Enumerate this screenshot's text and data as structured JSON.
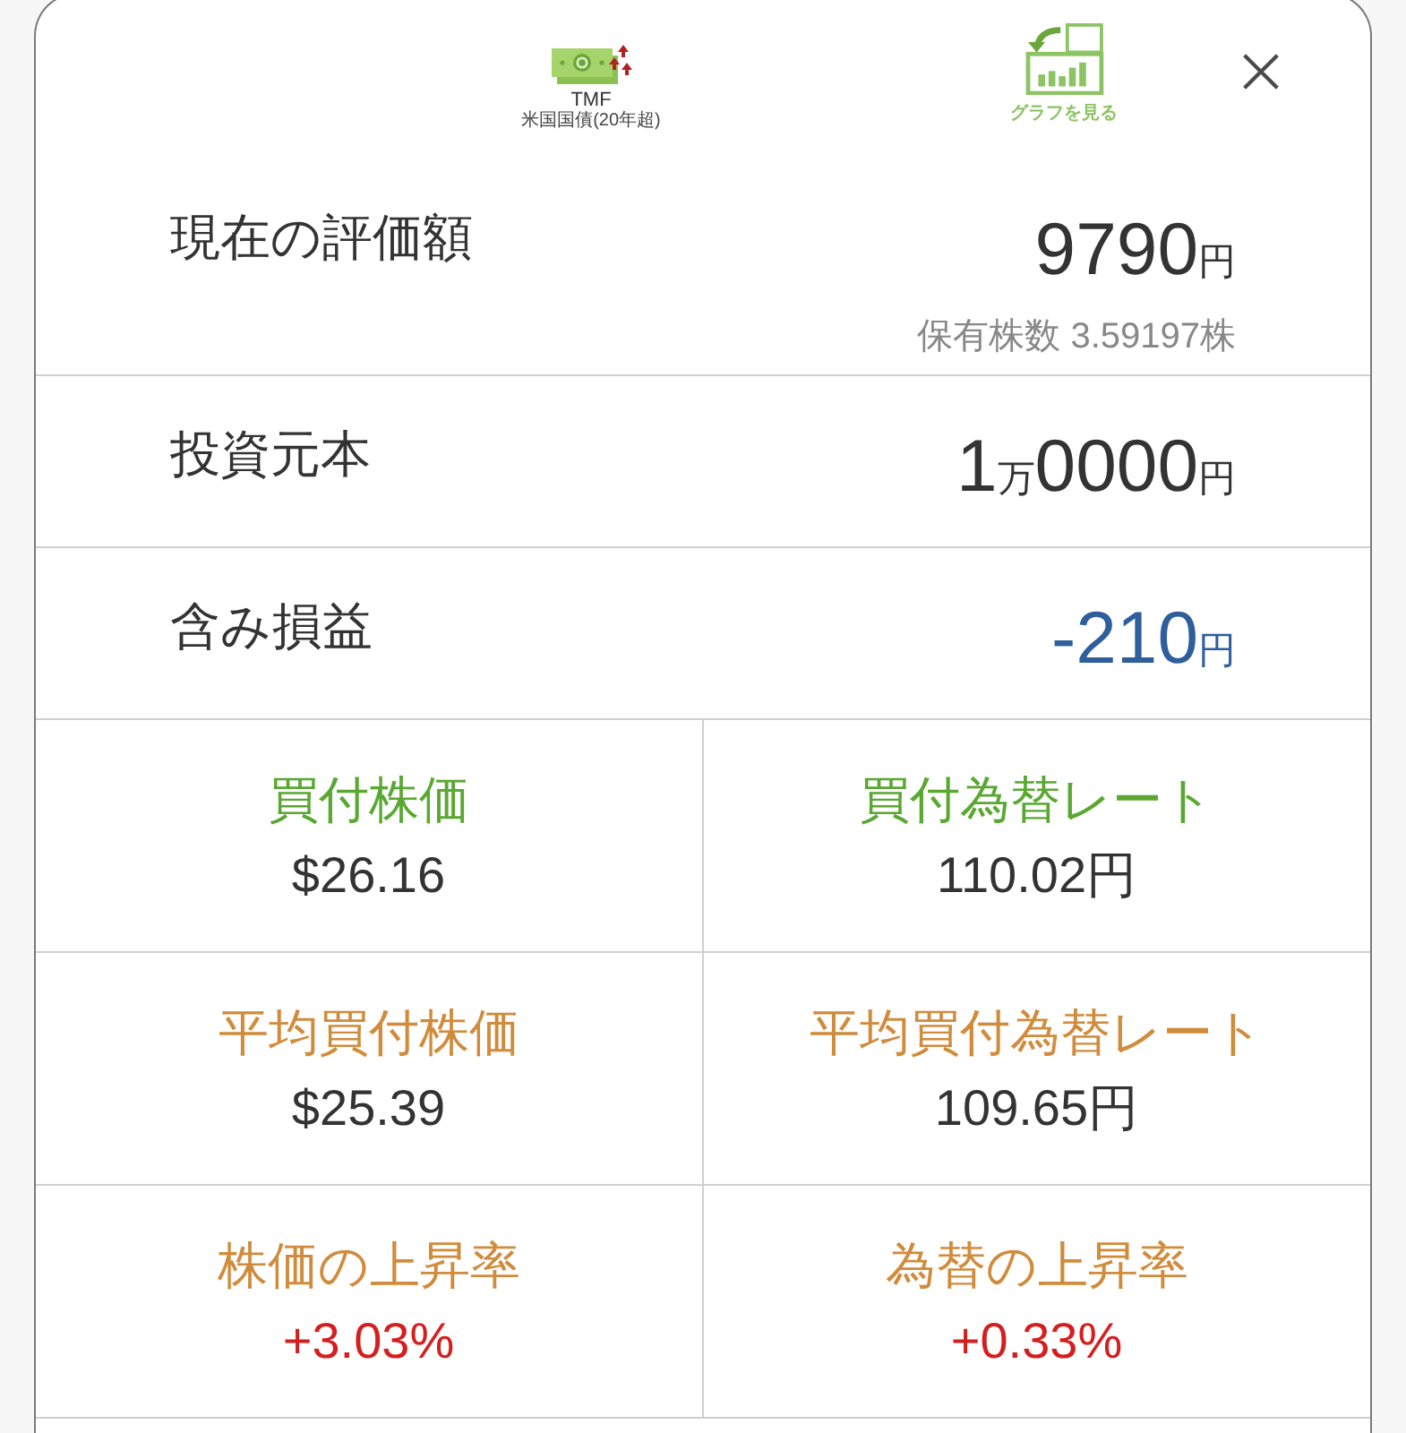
{
  "header": {
    "fund": {
      "ticker": "TMF",
      "subtitle": "米国国債(20年超)"
    },
    "graph_button": {
      "label": "グラフを見る"
    }
  },
  "summary_rows": [
    {
      "label": "現在の評価額",
      "amount": {
        "color": "#333333",
        "parts": [
          {
            "kind": "number",
            "text": "9790"
          },
          {
            "kind": "unit",
            "text": "円"
          }
        ]
      },
      "note": "保有株数 3.59197株"
    },
    {
      "label": "投資元本",
      "amount": {
        "color": "#333333",
        "parts": [
          {
            "kind": "number",
            "text": "1"
          },
          {
            "kind": "unit",
            "text": "万"
          },
          {
            "kind": "number",
            "text": "0000"
          },
          {
            "kind": "unit",
            "text": "円"
          }
        ]
      }
    },
    {
      "label": "含み損益",
      "amount": {
        "color": "#2f5e9c",
        "parts": [
          {
            "kind": "number",
            "text": "-210"
          },
          {
            "kind": "unit",
            "text": "円"
          }
        ]
      }
    }
  ],
  "stats": [
    {
      "label": {
        "text": "買付株価",
        "color": "#5aa832"
      },
      "value": {
        "text": "$26.16",
        "color": "#333333"
      }
    },
    {
      "label": {
        "text": "買付為替レート",
        "color": "#5aa832"
      },
      "value": {
        "text": "110.02円",
        "color": "#333333"
      }
    },
    {
      "label": {
        "text": "平均買付株価",
        "color": "#d08c3c"
      },
      "value": {
        "text": "$25.39",
        "color": "#333333"
      }
    },
    {
      "label": {
        "text": "平均買付為替レート",
        "color": "#d08c3c"
      },
      "value": {
        "text": "109.65円",
        "color": "#333333"
      }
    },
    {
      "label": {
        "text": "株価の上昇率",
        "color": "#d08c3c"
      },
      "value": {
        "text": "+3.03%",
        "color": "#d41f1f"
      }
    },
    {
      "label": {
        "text": "為替の上昇率",
        "color": "#d08c3c"
      },
      "value": {
        "text": "+0.33%",
        "color": "#d41f1f"
      }
    }
  ]
}
